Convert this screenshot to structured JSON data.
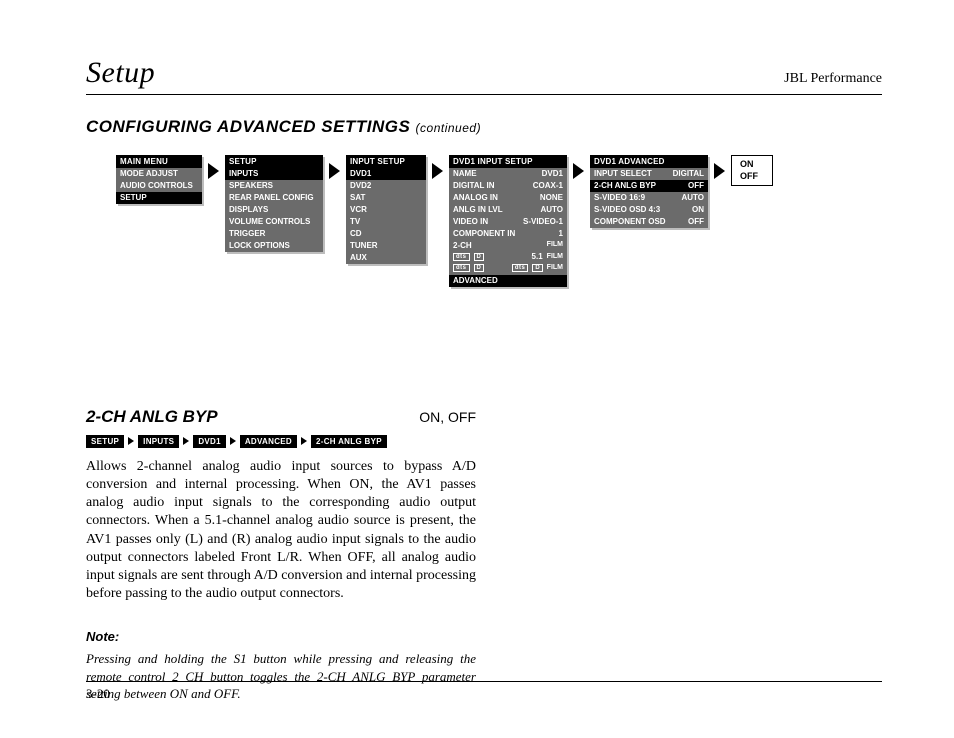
{
  "runhead": {
    "left": "Setup",
    "right": "JBL Performance"
  },
  "section": {
    "title": "CONFIGURING ADVANCED SETTINGS",
    "cont": "(continued)"
  },
  "menus": {
    "m1": {
      "header": "MAIN MENU",
      "rows": [
        "MODE ADJUST",
        "AUDIO CONTROLS",
        "SETUP"
      ],
      "selected": 2
    },
    "m2": {
      "header": "SETUP",
      "rows": [
        "INPUTS",
        "SPEAKERS",
        "REAR PANEL CONFIG",
        "DISPLAYS",
        "VOLUME CONTROLS",
        "TRIGGER",
        "LOCK OPTIONS"
      ],
      "selected": 0
    },
    "m3": {
      "header": "INPUT SETUP",
      "rows": [
        "DVD1",
        "DVD2",
        "SAT",
        "VCR",
        "TV",
        "CD",
        "TUNER",
        "AUX"
      ],
      "selected": 0
    },
    "m4": {
      "header": "DVD1 INPUT SETUP",
      "kv": [
        [
          "NAME",
          "DVD1"
        ],
        [
          "DIGITAL IN",
          "COAX-1"
        ],
        [
          "ANALOG IN",
          "NONE"
        ],
        [
          "ANLG IN LVL",
          "AUTO"
        ],
        [
          "VIDEO IN",
          "S-VIDEO-1"
        ],
        [
          "COMPONENT IN",
          "1"
        ],
        [
          "2-CH",
          "FILM"
        ]
      ],
      "sym1": {
        "dts": "dts",
        "dd": "D",
        "text": "5.1",
        "film": "FILM"
      },
      "sym2": {
        "dts": "dts",
        "dd": "D",
        "text": "",
        "film": "FILM"
      },
      "footer": "ADVANCED",
      "selected": -1
    },
    "m5": {
      "header": "DVD1 ADVANCED",
      "kv": [
        [
          "INPUT SELECT",
          "DIGITAL"
        ],
        [
          "2-CH ANLG BYP",
          "OFF"
        ],
        [
          "S-VIDEO 16:9",
          "AUTO"
        ],
        [
          "S-VIDEO OSD 4:3",
          "ON"
        ],
        [
          "COMPONENT OSD",
          "OFF"
        ]
      ],
      "selected": 1
    }
  },
  "onoff": {
    "on": "ON",
    "off": "OFF"
  },
  "param": {
    "name": "2-CH ANLG BYP",
    "values": "ON, OFF"
  },
  "path": [
    "SETUP",
    "INPUTS",
    "DVD1",
    "ADVANCED",
    "2-CH ANLG BYP"
  ],
  "paragraph": "Allows 2-channel analog audio input sources to bypass A/D conversion and internal processing. When ON, the AV1 passes analog audio input signals to the corresponding audio output connectors. When a 5.1-channel analog audio source is present, the AV1 passes only (L) and (R) analog audio input signals to the audio output connectors labeled Front L/R. When OFF, all analog audio input signals are sent through A/D conversion and internal processing before passing to the audio output connectors.",
  "note_label": "Note:",
  "note": "Pressing and holding the S1 button while pressing and releasing the remote control 2 CH button toggles the 2-CH ANLG BYP parameter setting  between ON and OFF.",
  "page": "3-20"
}
